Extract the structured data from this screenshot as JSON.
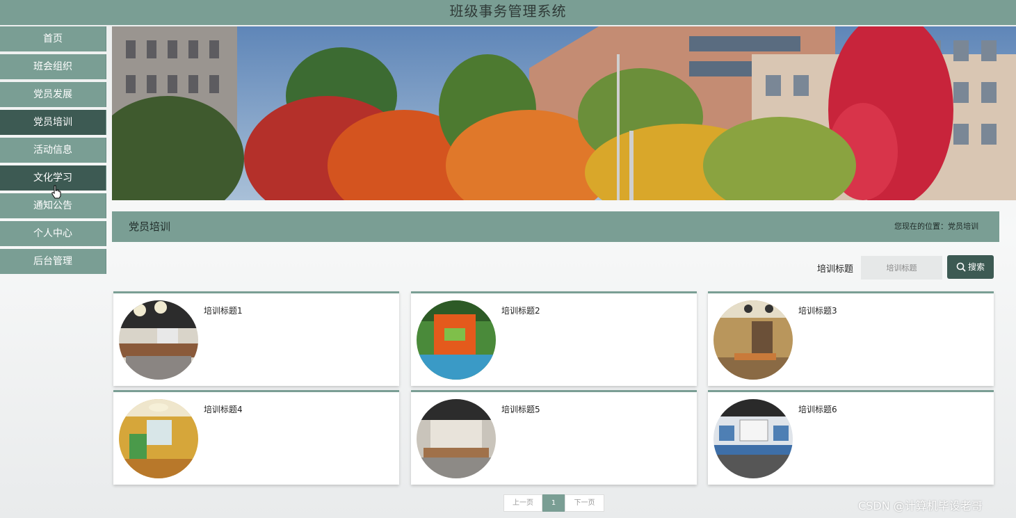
{
  "header": {
    "title": "班级事务管理系统"
  },
  "sidebar": {
    "items": [
      {
        "label": "首页"
      },
      {
        "label": "班会组织"
      },
      {
        "label": "党员发展"
      },
      {
        "label": "党员培训",
        "active": true
      },
      {
        "label": "活动信息"
      },
      {
        "label": "文化学习"
      },
      {
        "label": "通知公告"
      },
      {
        "label": "个人中心"
      },
      {
        "label": "后台管理"
      }
    ]
  },
  "section": {
    "title": "党员培训",
    "breadcrumb": "您现在的位置：党员培训"
  },
  "search": {
    "label": "培训标题",
    "placeholder": "培训标题",
    "button": "搜索"
  },
  "cards": [
    {
      "title": "培训标题1",
      "image": "classroom-interior"
    },
    {
      "title": "培训标题2",
      "image": "orange-green-room"
    },
    {
      "title": "培训标题3",
      "image": "wood-panel-room"
    },
    {
      "title": "培训标题4",
      "image": "yellow-activity-room"
    },
    {
      "title": "培训标题5",
      "image": "hall-with-tables"
    },
    {
      "title": "培训标题6",
      "image": "meeting-room"
    }
  ],
  "pagination": {
    "prev": "上一页",
    "current": "1",
    "next": "下一页"
  },
  "watermark": "CSDN @计算机毕设老哥",
  "colors": {
    "accent": "#7a9e94",
    "active": "#3d5a53"
  }
}
